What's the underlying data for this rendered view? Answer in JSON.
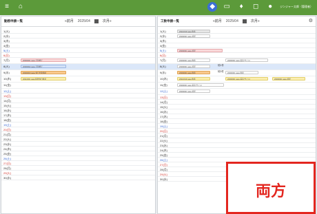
{
  "app": {
    "menu_icon": "hamburger-menu-icon",
    "home_icon": "home-icon",
    "header_icons": [
      "shield-icon",
      "inbox-icon",
      "bell-icon",
      "chat-icon"
    ],
    "user_name": "ジンジャー太郎（管理者）",
    "user_avatar": "avatar-icon",
    "accent_color": "#5c9a3a"
  },
  "left_panel": {
    "title": "勤務申請一覧",
    "prev_label": "«前月",
    "month": "2025/04",
    "next_label": "次月»",
    "calendar_icon": "calendar-icon",
    "days": [
      "1(火)",
      "2(水)",
      "3(木)",
      "4(金)",
      "5(土)",
      "6(日)",
      "7(月)",
      "8(火)",
      "9(水)",
      "10(木)",
      "11(金)",
      "12(土)",
      "13(日)",
      "14(月)",
      "15(火)",
      "16(水)",
      "17(木)",
      "18(金)",
      "19(土)",
      "20(日)",
      "21(月)",
      "22(火)",
      "23(水)",
      "24(木)",
      "25(金)",
      "26(土)",
      "27(日)",
      "28(月)",
      "29(火)",
      "30(水)"
    ],
    "entries": [
      {
        "day_index": 6,
        "text": "20000001 sasa 打刻修正"
      },
      {
        "day_index": 7,
        "text": "20000002 sasa 打刻修正"
      },
      {
        "day_index": 8,
        "text": "20000003 sasa 休日出勤申請"
      },
      {
        "day_index": 9,
        "text": "20110001 sasa 振替休日申請"
      }
    ]
  },
  "right_panel": {
    "title": "工数申請一覧",
    "prev_label": "«前月",
    "month": "2025/04",
    "next_label": "次月»",
    "calendar_icon": "calendar-icon",
    "settings_icon": "gear-icon",
    "days": [
      "1(火)",
      "2(水)",
      "3(木)",
      "4(金)",
      "5(土)",
      "6(日)",
      "7(月)",
      "8(火)",
      "9(水)",
      "10(木)",
      "11(金)",
      "12(土)",
      "13(日)",
      "14(月)",
      "15(火)",
      "16(水)",
      "17(木)",
      "18(金)",
      "19(土)",
      "20(日)",
      "21(月)",
      "22(火)",
      "23(水)",
      "24(木)",
      "25(金)",
      "26(土)",
      "27(日)",
      "28(月)",
      "29(火)",
      "30(水)"
    ],
    "entries": [
      {
        "day_index": 0,
        "text": "20110019 sasa 申請"
      },
      {
        "day_index": 1,
        "text": "20000001 sasa 承認"
      },
      {
        "day_index": 4,
        "text": "20000001 sasa 承認"
      },
      {
        "day_index": 6,
        "text": "20000001 sasa 申請"
      },
      {
        "day_index": 6,
        "text": "20000001 sasa 差戻(サイン)"
      },
      {
        "day_index": 7,
        "text": "20000001 sasa 承認"
      },
      {
        "day_index": 8,
        "text": "20000001 sasa 申請"
      },
      {
        "day_index": 8,
        "text": "20000001 sasa 申請"
      },
      {
        "day_index": 9,
        "text": "20110019 sasa 申請"
      },
      {
        "day_index": 9,
        "text": "20000001 sasa 差戻(サイン)"
      },
      {
        "day_index": 9,
        "text": "20000001 sasa 承認"
      },
      {
        "day_index": 10,
        "text": "20000001 sasa 差戻(サイン)"
      },
      {
        "day_index": 11,
        "text": "20000001 sasa 承認"
      }
    ],
    "count_badges": [
      "他1件",
      "他3件"
    ]
  },
  "callout": {
    "text": "両方"
  }
}
